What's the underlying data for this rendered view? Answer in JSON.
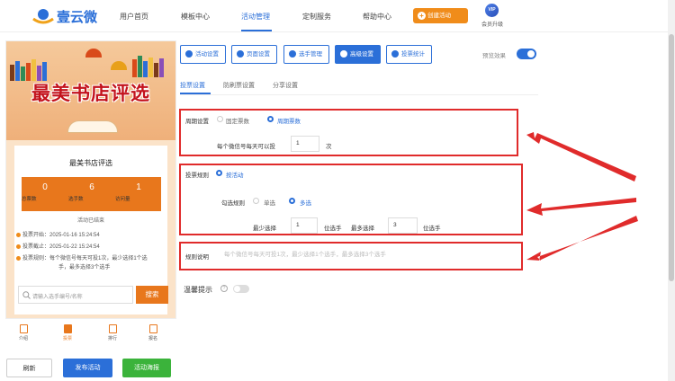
{
  "topnav": {
    "brand": "壹云微",
    "items": [
      "用户首页",
      "模板中心",
      "活动管理",
      "定制服务",
      "帮助中心"
    ],
    "create_button": "创建活动",
    "vip_badge": "VIP",
    "vip_label": "会员升级"
  },
  "preview": {
    "banner_title": "最美书店评选",
    "card_title": "最美书店评选",
    "stats": [
      {
        "value": "0",
        "label": "总票数"
      },
      {
        "value": "6",
        "label": "选手数"
      },
      {
        "value": "1",
        "label": "访问量"
      }
    ],
    "ended": "活动已结束",
    "info": [
      "投票开始：2025-01-16 15:24:54",
      "投票截止：2025-01-22 15:24:54",
      "投票规则：每个微信号每天可投1次，最少选择1个选",
      "手，最多选择3个选手"
    ],
    "search_placeholder": "请输入选手编号/名称",
    "search_button": "搜索",
    "tabs": [
      "介绍",
      "投票",
      "排行",
      "报名"
    ]
  },
  "bottom_buttons": [
    "刷新",
    "发布活动",
    "活动海报"
  ],
  "toolbar": {
    "buttons": [
      "活动设置",
      "页面设置",
      "选手管理",
      "高级设置",
      "投票统计"
    ],
    "preview_label": "预览效果"
  },
  "subtabs": [
    "投票设置",
    "防刷票设置",
    "分享设置"
  ],
  "cycle": {
    "label": "周期设置",
    "opt_fixed": "固定票数",
    "opt_cycle": "周期票数",
    "per_day_label": "每个微信号每天可以投",
    "per_day_value": "1",
    "per_day_unit": "次"
  },
  "rule": {
    "label": "投票规则",
    "opt_activity": "按活动",
    "check_label": "勾选规则",
    "opt_single": "单选",
    "opt_multi": "多选",
    "min_label": "最少选择",
    "min_value": "1",
    "min_unit": "位选手",
    "max_label": "最多选择",
    "max_value": "3",
    "max_unit": "位选手"
  },
  "desc": {
    "label": "规则说明",
    "placeholder": "每个微信号每天可投1次，最少选择1个选手，最多选择3个选手"
  },
  "tip": {
    "label": "温馨提示"
  }
}
